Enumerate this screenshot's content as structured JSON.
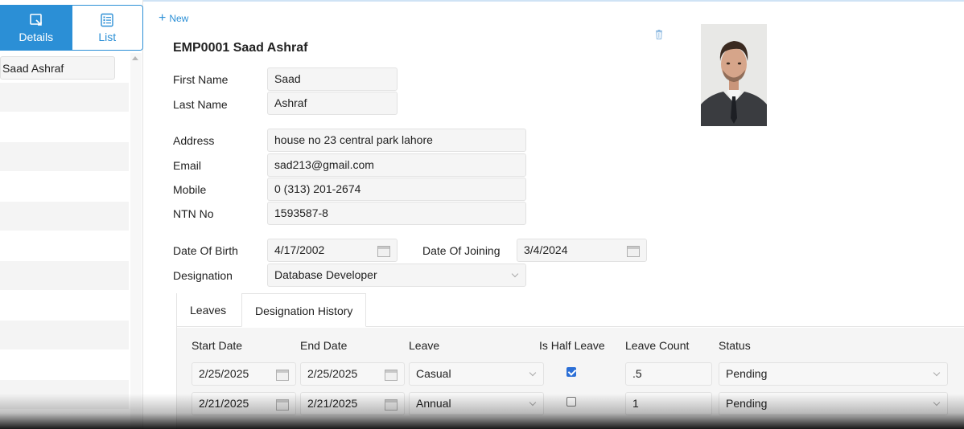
{
  "left_panel": {
    "modes": [
      {
        "label": "Details",
        "icon": "details-icon",
        "active": true
      },
      {
        "label": "List",
        "icon": "list-icon",
        "active": false
      }
    ],
    "employees": [
      "Saad Ashraf"
    ]
  },
  "toolbar": {
    "new_label": "New",
    "delete_icon": "trash-icon"
  },
  "employee": {
    "title": "EMP0001 Saad Ashraf",
    "photo_icon": "employee-photo",
    "fields": {
      "first_name": {
        "label": "First Name",
        "value": "Saad"
      },
      "last_name": {
        "label": "Last Name",
        "value": "Ashraf"
      },
      "address": {
        "label": "Address",
        "value": "house no 23 central park lahore"
      },
      "email": {
        "label": "Email",
        "value": "sad213@gmail.com"
      },
      "mobile": {
        "label": "Mobile",
        "value": "0 (313) 201-2674"
      },
      "ntn": {
        "label": "NTN No",
        "value": "1593587-8"
      },
      "dob": {
        "label": "Date Of Birth",
        "value": "4/17/2002"
      },
      "doj": {
        "label": "Date Of Joining",
        "value": "3/4/2024"
      },
      "designation": {
        "label": "Designation",
        "value": "Database Developer"
      }
    }
  },
  "tabs": [
    {
      "label": "Leaves",
      "active": false
    },
    {
      "label": "Designation History",
      "active": true
    }
  ],
  "leaves_grid": {
    "columns": [
      "Start Date",
      "End Date",
      "Leave",
      "Is Half Leave",
      "Leave Count",
      "Status"
    ],
    "rows": [
      {
        "start": "2/25/2025",
        "end": "2/25/2025",
        "leave": "Casual",
        "half": true,
        "count": ".5",
        "status": "Pending"
      },
      {
        "start": "2/21/2025",
        "end": "2/21/2025",
        "leave": "Annual",
        "half": false,
        "count": "1",
        "status": "Pending"
      }
    ]
  },
  "colors": {
    "accent": "#2b8fd6",
    "field_bg": "#f5f5f5",
    "checkbox": "#2b6fd6"
  }
}
